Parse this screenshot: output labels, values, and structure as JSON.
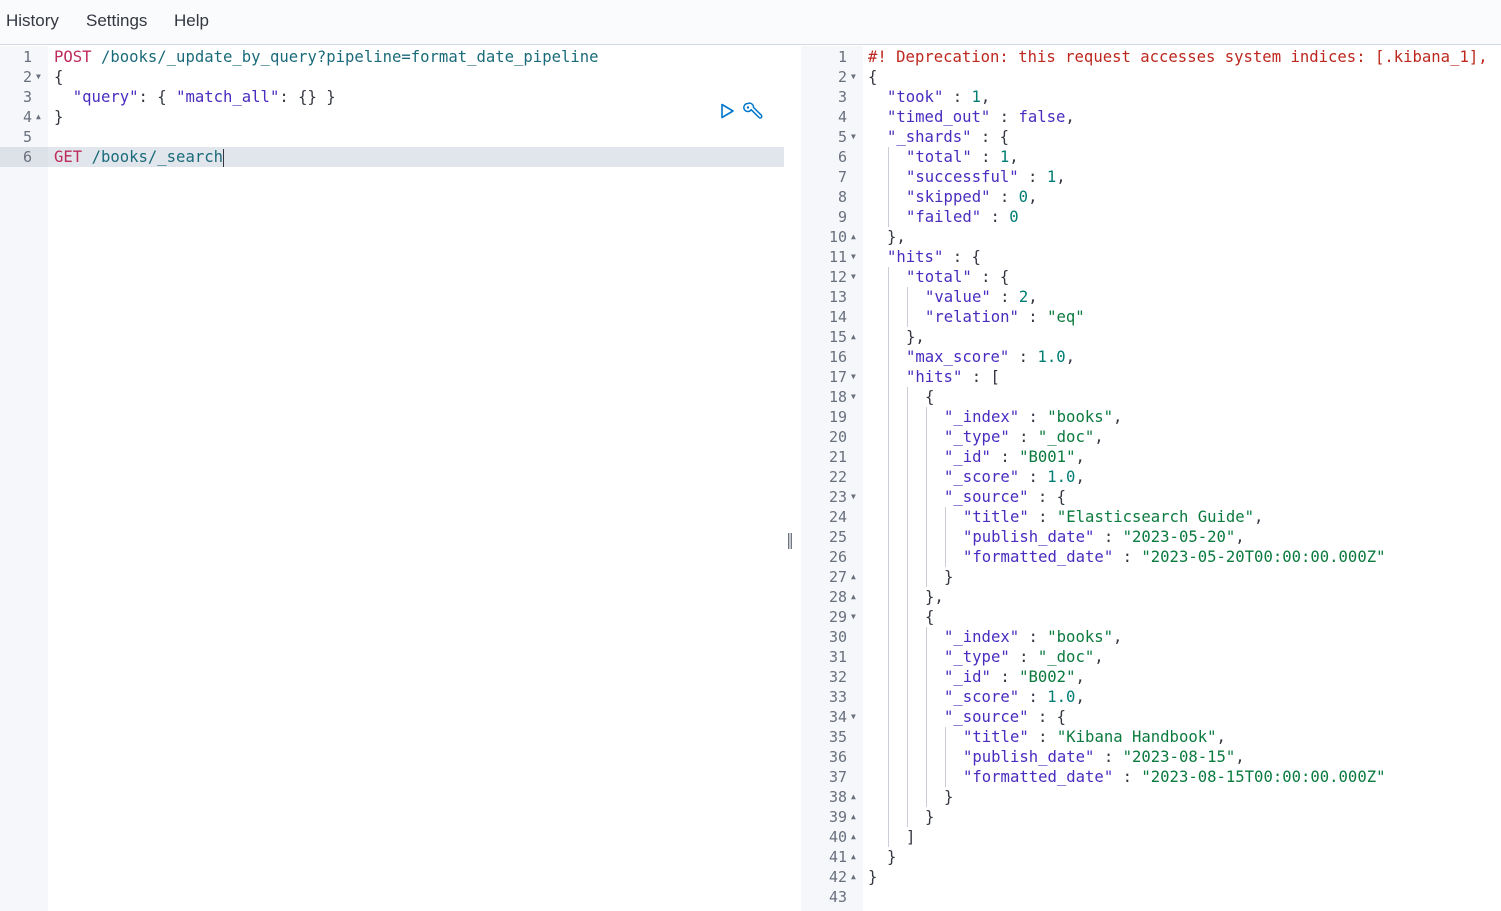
{
  "menu": {
    "items": [
      "History",
      "Settings",
      "Help"
    ]
  },
  "request": {
    "active_line": 6,
    "lines": [
      {
        "num": "1",
        "fold": "",
        "indent": 0,
        "tokens": [
          {
            "t": "POST",
            "c": "k"
          },
          {
            "t": " ",
            "c": "p"
          },
          {
            "t": "/books/_update_by_query?pipeline=format_date_pipeline",
            "c": "u"
          }
        ]
      },
      {
        "num": "2",
        "fold": "open",
        "indent": 0,
        "tokens": [
          {
            "t": "{",
            "c": "p"
          }
        ]
      },
      {
        "num": "3",
        "fold": "",
        "indent": 0,
        "tokens": [
          {
            "t": "  ",
            "c": "p"
          },
          {
            "t": "\"query\"",
            "c": "b"
          },
          {
            "t": ": { ",
            "c": "p"
          },
          {
            "t": "\"match_all\"",
            "c": "b"
          },
          {
            "t": ": {} }",
            "c": "p"
          }
        ]
      },
      {
        "num": "4",
        "fold": "close",
        "indent": 0,
        "tokens": [
          {
            "t": "}",
            "c": "p"
          }
        ]
      },
      {
        "num": "5",
        "fold": "",
        "indent": 0,
        "tokens": []
      },
      {
        "num": "6",
        "fold": "",
        "indent": 0,
        "tokens": [
          {
            "t": "GET",
            "c": "k"
          },
          {
            "t": " ",
            "c": "p"
          },
          {
            "t": "/books/_search",
            "c": "u"
          }
        ]
      }
    ],
    "actions": {
      "run_icon": "play-icon",
      "settings_icon": "wrench-icon"
    }
  },
  "response": {
    "lines": [
      {
        "num": "1",
        "fold": "",
        "indent": 0,
        "tokens": [
          {
            "t": "#! Deprecation: this request accesses system indices: [.kibana_1],",
            "c": "d"
          }
        ]
      },
      {
        "num": "2",
        "fold": "open",
        "indent": 0,
        "tokens": [
          {
            "t": "{",
            "c": "p"
          }
        ]
      },
      {
        "num": "3",
        "fold": "",
        "indent": 1,
        "tokens": [
          {
            "t": "\"took\"",
            "c": "b"
          },
          {
            "t": " : ",
            "c": "p"
          },
          {
            "t": "1",
            "c": "n"
          },
          {
            "t": ",",
            "c": "p"
          }
        ]
      },
      {
        "num": "4",
        "fold": "",
        "indent": 1,
        "tokens": [
          {
            "t": "\"timed_out\"",
            "c": "b"
          },
          {
            "t": " : ",
            "c": "p"
          },
          {
            "t": "false",
            "c": "b"
          },
          {
            "t": ",",
            "c": "p"
          }
        ]
      },
      {
        "num": "5",
        "fold": "open",
        "indent": 1,
        "tokens": [
          {
            "t": "\"_shards\"",
            "c": "b"
          },
          {
            "t": " : {",
            "c": "p"
          }
        ]
      },
      {
        "num": "6",
        "fold": "",
        "indent": 2,
        "tokens": [
          {
            "t": "\"total\"",
            "c": "b"
          },
          {
            "t": " : ",
            "c": "p"
          },
          {
            "t": "1",
            "c": "n"
          },
          {
            "t": ",",
            "c": "p"
          }
        ]
      },
      {
        "num": "7",
        "fold": "",
        "indent": 2,
        "tokens": [
          {
            "t": "\"successful\"",
            "c": "b"
          },
          {
            "t": " : ",
            "c": "p"
          },
          {
            "t": "1",
            "c": "n"
          },
          {
            "t": ",",
            "c": "p"
          }
        ]
      },
      {
        "num": "8",
        "fold": "",
        "indent": 2,
        "tokens": [
          {
            "t": "\"skipped\"",
            "c": "b"
          },
          {
            "t": " : ",
            "c": "p"
          },
          {
            "t": "0",
            "c": "n"
          },
          {
            "t": ",",
            "c": "p"
          }
        ]
      },
      {
        "num": "9",
        "fold": "",
        "indent": 2,
        "tokens": [
          {
            "t": "\"failed\"",
            "c": "b"
          },
          {
            "t": " : ",
            "c": "p"
          },
          {
            "t": "0",
            "c": "n"
          }
        ]
      },
      {
        "num": "10",
        "fold": "close",
        "indent": 1,
        "tokens": [
          {
            "t": "},",
            "c": "p"
          }
        ]
      },
      {
        "num": "11",
        "fold": "open",
        "indent": 1,
        "tokens": [
          {
            "t": "\"hits\"",
            "c": "b"
          },
          {
            "t": " : {",
            "c": "p"
          }
        ]
      },
      {
        "num": "12",
        "fold": "open",
        "indent": 2,
        "tokens": [
          {
            "t": "\"total\"",
            "c": "b"
          },
          {
            "t": " : {",
            "c": "p"
          }
        ]
      },
      {
        "num": "13",
        "fold": "",
        "indent": 3,
        "tokens": [
          {
            "t": "\"value\"",
            "c": "b"
          },
          {
            "t": " : ",
            "c": "p"
          },
          {
            "t": "2",
            "c": "n"
          },
          {
            "t": ",",
            "c": "p"
          }
        ]
      },
      {
        "num": "14",
        "fold": "",
        "indent": 3,
        "tokens": [
          {
            "t": "\"relation\"",
            "c": "b"
          },
          {
            "t": " : ",
            "c": "p"
          },
          {
            "t": "\"eq\"",
            "c": "s"
          }
        ]
      },
      {
        "num": "15",
        "fold": "close",
        "indent": 2,
        "tokens": [
          {
            "t": "},",
            "c": "p"
          }
        ]
      },
      {
        "num": "16",
        "fold": "",
        "indent": 2,
        "tokens": [
          {
            "t": "\"max_score\"",
            "c": "b"
          },
          {
            "t": " : ",
            "c": "p"
          },
          {
            "t": "1.0",
            "c": "n"
          },
          {
            "t": ",",
            "c": "p"
          }
        ]
      },
      {
        "num": "17",
        "fold": "open",
        "indent": 2,
        "tokens": [
          {
            "t": "\"hits\"",
            "c": "b"
          },
          {
            "t": " : [",
            "c": "p"
          }
        ]
      },
      {
        "num": "18",
        "fold": "open",
        "indent": 3,
        "tokens": [
          {
            "t": "{",
            "c": "p"
          }
        ]
      },
      {
        "num": "19",
        "fold": "",
        "indent": 4,
        "tokens": [
          {
            "t": "\"_index\"",
            "c": "b"
          },
          {
            "t": " : ",
            "c": "p"
          },
          {
            "t": "\"books\"",
            "c": "s"
          },
          {
            "t": ",",
            "c": "p"
          }
        ]
      },
      {
        "num": "20",
        "fold": "",
        "indent": 4,
        "tokens": [
          {
            "t": "\"_type\"",
            "c": "b"
          },
          {
            "t": " : ",
            "c": "p"
          },
          {
            "t": "\"_doc\"",
            "c": "s"
          },
          {
            "t": ",",
            "c": "p"
          }
        ]
      },
      {
        "num": "21",
        "fold": "",
        "indent": 4,
        "tokens": [
          {
            "t": "\"_id\"",
            "c": "b"
          },
          {
            "t": " : ",
            "c": "p"
          },
          {
            "t": "\"B001\"",
            "c": "s"
          },
          {
            "t": ",",
            "c": "p"
          }
        ]
      },
      {
        "num": "22",
        "fold": "",
        "indent": 4,
        "tokens": [
          {
            "t": "\"_score\"",
            "c": "b"
          },
          {
            "t": " : ",
            "c": "p"
          },
          {
            "t": "1.0",
            "c": "n"
          },
          {
            "t": ",",
            "c": "p"
          }
        ]
      },
      {
        "num": "23",
        "fold": "open",
        "indent": 4,
        "tokens": [
          {
            "t": "\"_source\"",
            "c": "b"
          },
          {
            "t": " : {",
            "c": "p"
          }
        ]
      },
      {
        "num": "24",
        "fold": "",
        "indent": 5,
        "tokens": [
          {
            "t": "\"title\"",
            "c": "b"
          },
          {
            "t": " : ",
            "c": "p"
          },
          {
            "t": "\"Elasticsearch Guide\"",
            "c": "s"
          },
          {
            "t": ",",
            "c": "p"
          }
        ]
      },
      {
        "num": "25",
        "fold": "",
        "indent": 5,
        "tokens": [
          {
            "t": "\"publish_date\"",
            "c": "b"
          },
          {
            "t": " : ",
            "c": "p"
          },
          {
            "t": "\"2023-05-20\"",
            "c": "s"
          },
          {
            "t": ",",
            "c": "p"
          }
        ]
      },
      {
        "num": "26",
        "fold": "",
        "indent": 5,
        "tokens": [
          {
            "t": "\"formatted_date\"",
            "c": "b"
          },
          {
            "t": " : ",
            "c": "p"
          },
          {
            "t": "\"2023-05-20T00:00:00.000Z\"",
            "c": "s"
          }
        ]
      },
      {
        "num": "27",
        "fold": "close",
        "indent": 4,
        "tokens": [
          {
            "t": "}",
            "c": "p"
          }
        ]
      },
      {
        "num": "28",
        "fold": "close",
        "indent": 3,
        "tokens": [
          {
            "t": "},",
            "c": "p"
          }
        ]
      },
      {
        "num": "29",
        "fold": "open",
        "indent": 3,
        "tokens": [
          {
            "t": "{",
            "c": "p"
          }
        ]
      },
      {
        "num": "30",
        "fold": "",
        "indent": 4,
        "tokens": [
          {
            "t": "\"_index\"",
            "c": "b"
          },
          {
            "t": " : ",
            "c": "p"
          },
          {
            "t": "\"books\"",
            "c": "s"
          },
          {
            "t": ",",
            "c": "p"
          }
        ]
      },
      {
        "num": "31",
        "fold": "",
        "indent": 4,
        "tokens": [
          {
            "t": "\"_type\"",
            "c": "b"
          },
          {
            "t": " : ",
            "c": "p"
          },
          {
            "t": "\"_doc\"",
            "c": "s"
          },
          {
            "t": ",",
            "c": "p"
          }
        ]
      },
      {
        "num": "32",
        "fold": "",
        "indent": 4,
        "tokens": [
          {
            "t": "\"_id\"",
            "c": "b"
          },
          {
            "t": " : ",
            "c": "p"
          },
          {
            "t": "\"B002\"",
            "c": "s"
          },
          {
            "t": ",",
            "c": "p"
          }
        ]
      },
      {
        "num": "33",
        "fold": "",
        "indent": 4,
        "tokens": [
          {
            "t": "\"_score\"",
            "c": "b"
          },
          {
            "t": " : ",
            "c": "p"
          },
          {
            "t": "1.0",
            "c": "n"
          },
          {
            "t": ",",
            "c": "p"
          }
        ]
      },
      {
        "num": "34",
        "fold": "open",
        "indent": 4,
        "tokens": [
          {
            "t": "\"_source\"",
            "c": "b"
          },
          {
            "t": " : {",
            "c": "p"
          }
        ]
      },
      {
        "num": "35",
        "fold": "",
        "indent": 5,
        "tokens": [
          {
            "t": "\"title\"",
            "c": "b"
          },
          {
            "t": " : ",
            "c": "p"
          },
          {
            "t": "\"Kibana Handbook\"",
            "c": "s"
          },
          {
            "t": ",",
            "c": "p"
          }
        ]
      },
      {
        "num": "36",
        "fold": "",
        "indent": 5,
        "tokens": [
          {
            "t": "\"publish_date\"",
            "c": "b"
          },
          {
            "t": " : ",
            "c": "p"
          },
          {
            "t": "\"2023-08-15\"",
            "c": "s"
          },
          {
            "t": ",",
            "c": "p"
          }
        ]
      },
      {
        "num": "37",
        "fold": "",
        "indent": 5,
        "tokens": [
          {
            "t": "\"formatted_date\"",
            "c": "b"
          },
          {
            "t": " : ",
            "c": "p"
          },
          {
            "t": "\"2023-08-15T00:00:00.000Z\"",
            "c": "s"
          }
        ]
      },
      {
        "num": "38",
        "fold": "close",
        "indent": 4,
        "tokens": [
          {
            "t": "}",
            "c": "p"
          }
        ]
      },
      {
        "num": "39",
        "fold": "close",
        "indent": 3,
        "tokens": [
          {
            "t": "}",
            "c": "p"
          }
        ]
      },
      {
        "num": "40",
        "fold": "close",
        "indent": 2,
        "tokens": [
          {
            "t": "]",
            "c": "p"
          }
        ]
      },
      {
        "num": "41",
        "fold": "close",
        "indent": 1,
        "tokens": [
          {
            "t": "}",
            "c": "p"
          }
        ]
      },
      {
        "num": "42",
        "fold": "close",
        "indent": 0,
        "tokens": [
          {
            "t": "}",
            "c": "p"
          }
        ]
      },
      {
        "num": "43",
        "fold": "",
        "indent": 0,
        "tokens": []
      }
    ]
  },
  "colors": {
    "keyword": "#bd2c5a",
    "url": "#1a6b7a",
    "string": "#0b7a3e",
    "number": "#017d73",
    "key": "#4a2cbf",
    "deprecation": "#bd271e",
    "run_icon": "#0077cc"
  }
}
